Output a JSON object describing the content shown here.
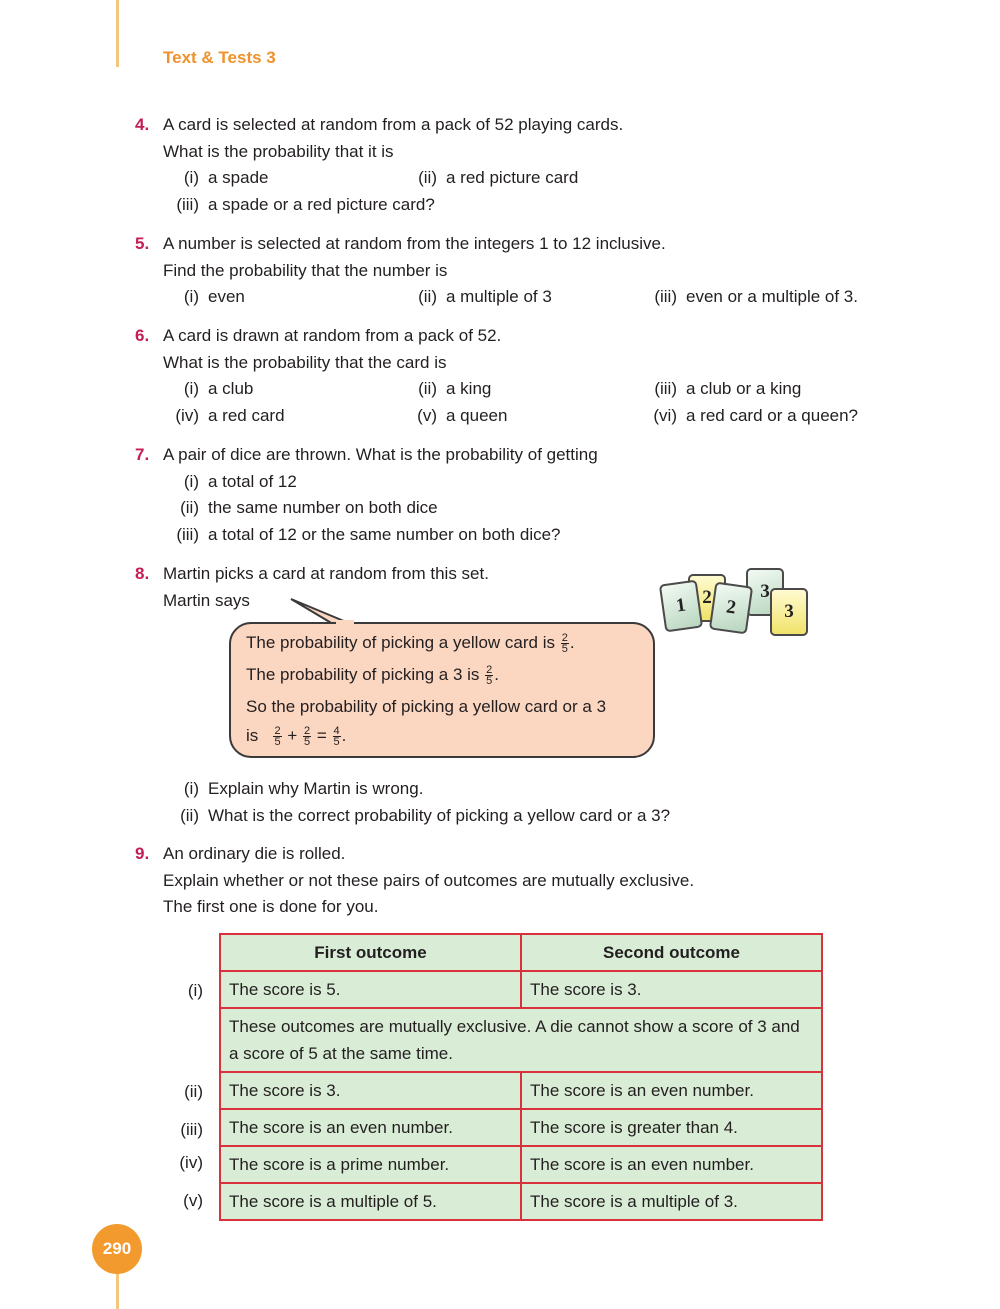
{
  "header": {
    "title": "Text & Tests 3"
  },
  "page_number": "290",
  "questions": {
    "q4": {
      "num": "4.",
      "lines": [
        "A card is selected at random from a pack of 52 playing cards.",
        "What is the probability that it is"
      ],
      "parts": [
        {
          "roman": "(i)",
          "text": "a spade"
        },
        {
          "roman": "(ii)",
          "text": "a red picture card"
        },
        {
          "roman": "(iii)",
          "text": "a spade or a red picture card?"
        }
      ]
    },
    "q5": {
      "num": "5.",
      "lines": [
        "A number is selected at random from the integers 1 to 12 inclusive.",
        "Find the probability that the number is"
      ],
      "parts": [
        {
          "roman": "(i)",
          "text": "even"
        },
        {
          "roman": "(ii)",
          "text": "a multiple of 3"
        },
        {
          "roman": "(iii)",
          "text": "even or a multiple of 3."
        }
      ]
    },
    "q6": {
      "num": "6.",
      "lines": [
        "A card is drawn at random from a pack of 52.",
        "What is the probability that the card is"
      ],
      "parts": [
        {
          "roman": "(i)",
          "text": "a club"
        },
        {
          "roman": "(ii)",
          "text": "a king"
        },
        {
          "roman": "(iii)",
          "text": "a club or a king"
        },
        {
          "roman": "(iv)",
          "text": "a red card"
        },
        {
          "roman": "(v)",
          "text": "a queen"
        },
        {
          "roman": "(vi)",
          "text": "a red card or a queen?"
        }
      ]
    },
    "q7": {
      "num": "7.",
      "lines": [
        "A pair of dice are thrown. What is the probability of getting"
      ],
      "parts": [
        {
          "roman": "(i)",
          "text": "a total of 12"
        },
        {
          "roman": "(ii)",
          "text": "the same number on both dice"
        },
        {
          "roman": "(iii)",
          "text": "a total of 12 or the same number on both dice?"
        }
      ]
    },
    "q8": {
      "num": "8.",
      "lines": [
        "Martin picks a card at random from this set.",
        "Martin says"
      ],
      "bubble": {
        "line1": "The probability of picking a yellow card is",
        "line2": "The probability of picking a 3 is",
        "line3": "So the probability of picking a yellow card or a 3",
        "line4": "is",
        "frac_num": "2",
        "frac_den": "5",
        "sum_num": "4",
        "plus": "+",
        "equals": "="
      },
      "cards": [
        {
          "label": "1",
          "color": "green"
        },
        {
          "label": "2",
          "color": "yellow"
        },
        {
          "label": "2",
          "color": "green"
        },
        {
          "label": "3",
          "color": "green"
        },
        {
          "label": "3",
          "color": "yellow"
        }
      ],
      "parts": [
        {
          "roman": "(i)",
          "text": "Explain why Martin is wrong."
        },
        {
          "roman": "(ii)",
          "text": "What is the correct probability of picking a yellow card or a 3?"
        }
      ]
    },
    "q9": {
      "num": "9.",
      "lines": [
        "An ordinary die is rolled.",
        "Explain whether or not these pairs of outcomes are mutually exclusive.",
        "The first one is done for you."
      ],
      "table": {
        "headers": [
          "First outcome",
          "Second outcome"
        ],
        "rows": [
          {
            "label": "(i)",
            "first": "The score is 5.",
            "second": "The score is 3."
          },
          {
            "label": "(ii)",
            "first": "The score is 3.",
            "second": "The score is an even number."
          },
          {
            "label": "(iii)",
            "first": "The score is an even number.",
            "second": "The score is greater than 4."
          },
          {
            "label": "(iv)",
            "first": "The score is a prime number.",
            "second": "The score is an even number."
          },
          {
            "label": "(v)",
            "first": "The score is a multiple of 5.",
            "second": "The score is a multiple of 3."
          }
        ],
        "example_answer": "These outcomes are mutually exclusive. A die cannot show a score of 3 and a score of 5 at the same time."
      }
    }
  },
  "colors": {
    "accent_orange": "#f0922b",
    "question_number": "#c41e57",
    "table_border": "#d8323c",
    "table_fill": "#d9ecd5",
    "bubble_fill": "#fbd6c0"
  }
}
